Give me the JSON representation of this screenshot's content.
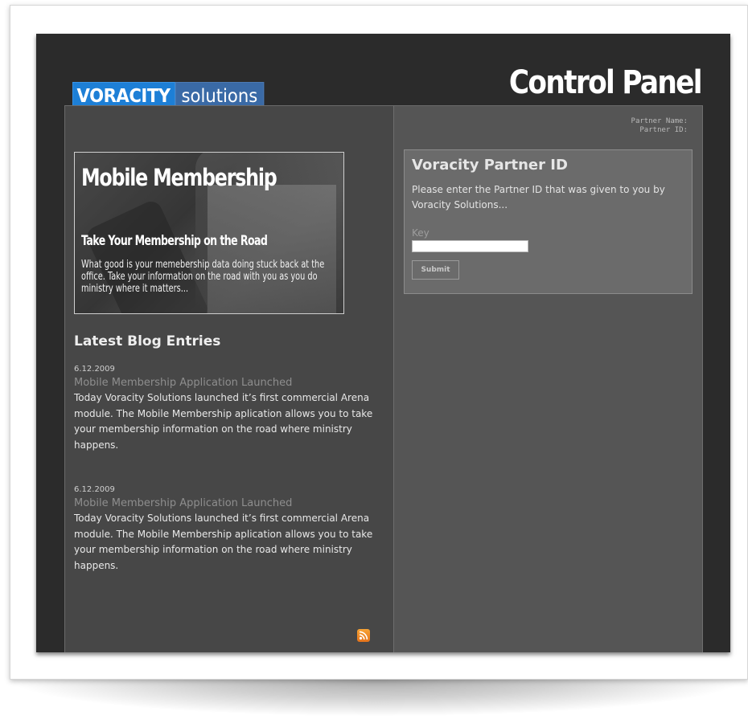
{
  "header": {
    "logo_brand": "VORACITY",
    "logo_sub": "solutions",
    "title": "Control Panel"
  },
  "partner_info": {
    "name_label": "Partner Name:",
    "id_label": "Partner ID:"
  },
  "banner": {
    "title": "Mobile Membership",
    "subtitle": "Take Your Membership on the Road",
    "body": "What good is your memebership data doing stuck back at the office. Take your information on the road with you as you do ministry where it matters..."
  },
  "blog": {
    "heading": "Latest Blog Entries",
    "entries": [
      {
        "date": "6.12.2009",
        "title": "Mobile Membership Application Launched",
        "body": "Today Voracity Solutions launched it’s first commercial Arena module. The Mobile Membership aplication allows you to take your membership information on the road where ministry happens."
      },
      {
        "date": "6.12.2009",
        "title": "Mobile Membership Application Launched",
        "body": "Today Voracity Solutions launched it’s first commercial Arena module. The Mobile Membership aplication allows you to take your membership information on the road where ministry happens."
      }
    ],
    "rss_icon": "rss-icon"
  },
  "partner_panel": {
    "title": "Voracity Partner ID",
    "description": "Please enter the Partner ID that was given to you by Voracity Solutions...",
    "key_label": "Key",
    "key_value": "",
    "submit_label": "Submit"
  },
  "colors": {
    "frame": "#2b2b2b",
    "left_column": "#474747",
    "right_column": "#555555",
    "logo_blue": "#1d7fd6",
    "rss_orange": "#f08a24"
  }
}
